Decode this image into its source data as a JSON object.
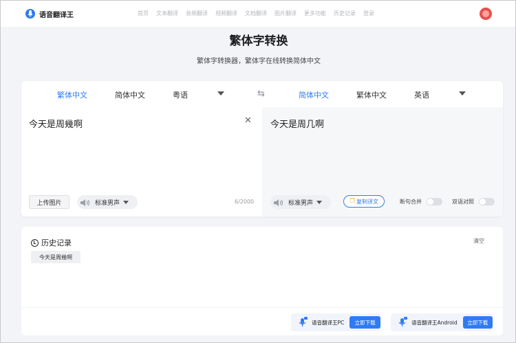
{
  "brand": {
    "name": "语音翻译王",
    "accent": "#2f7bf5"
  },
  "nav": {
    "items": [
      "首页",
      "文本翻译",
      "音频翻译",
      "视频翻译",
      "文档翻译",
      "图片翻译",
      "更多功能",
      "历史记录",
      "登录"
    ]
  },
  "header": {
    "title": "繁体字转换",
    "subtitle": "繁体字转换器，繁体字在线转换简体中文"
  },
  "translator": {
    "source_langs": [
      "繁体中文",
      "简体中文",
      "粤语"
    ],
    "source_active": "繁体中文",
    "target_langs": [
      "简体中文",
      "繁体中文",
      "英语"
    ],
    "target_active": "简体中文",
    "source_text": "今天是周幾啊",
    "target_text": "今天是周几啊",
    "upload_label": "上传图片",
    "voice_left": "标准男声",
    "voice_right": "标准男声",
    "char_count": "6/2000",
    "copy_label": "复制译文",
    "toggle_merge_label": "断句合并",
    "toggle_bilingual_label": "双语对照",
    "toggle_merge_on": false,
    "toggle_bilingual_on": false
  },
  "history": {
    "title": "历史记录",
    "clear_label": "清空",
    "items": [
      "今天是周幾啊"
    ]
  },
  "downloads": [
    {
      "name": "语音翻译王PC",
      "badge": "PC",
      "button": "立即下载"
    },
    {
      "name": "语音翻译王Android",
      "badge": "APP",
      "button": "立即下载"
    }
  ]
}
